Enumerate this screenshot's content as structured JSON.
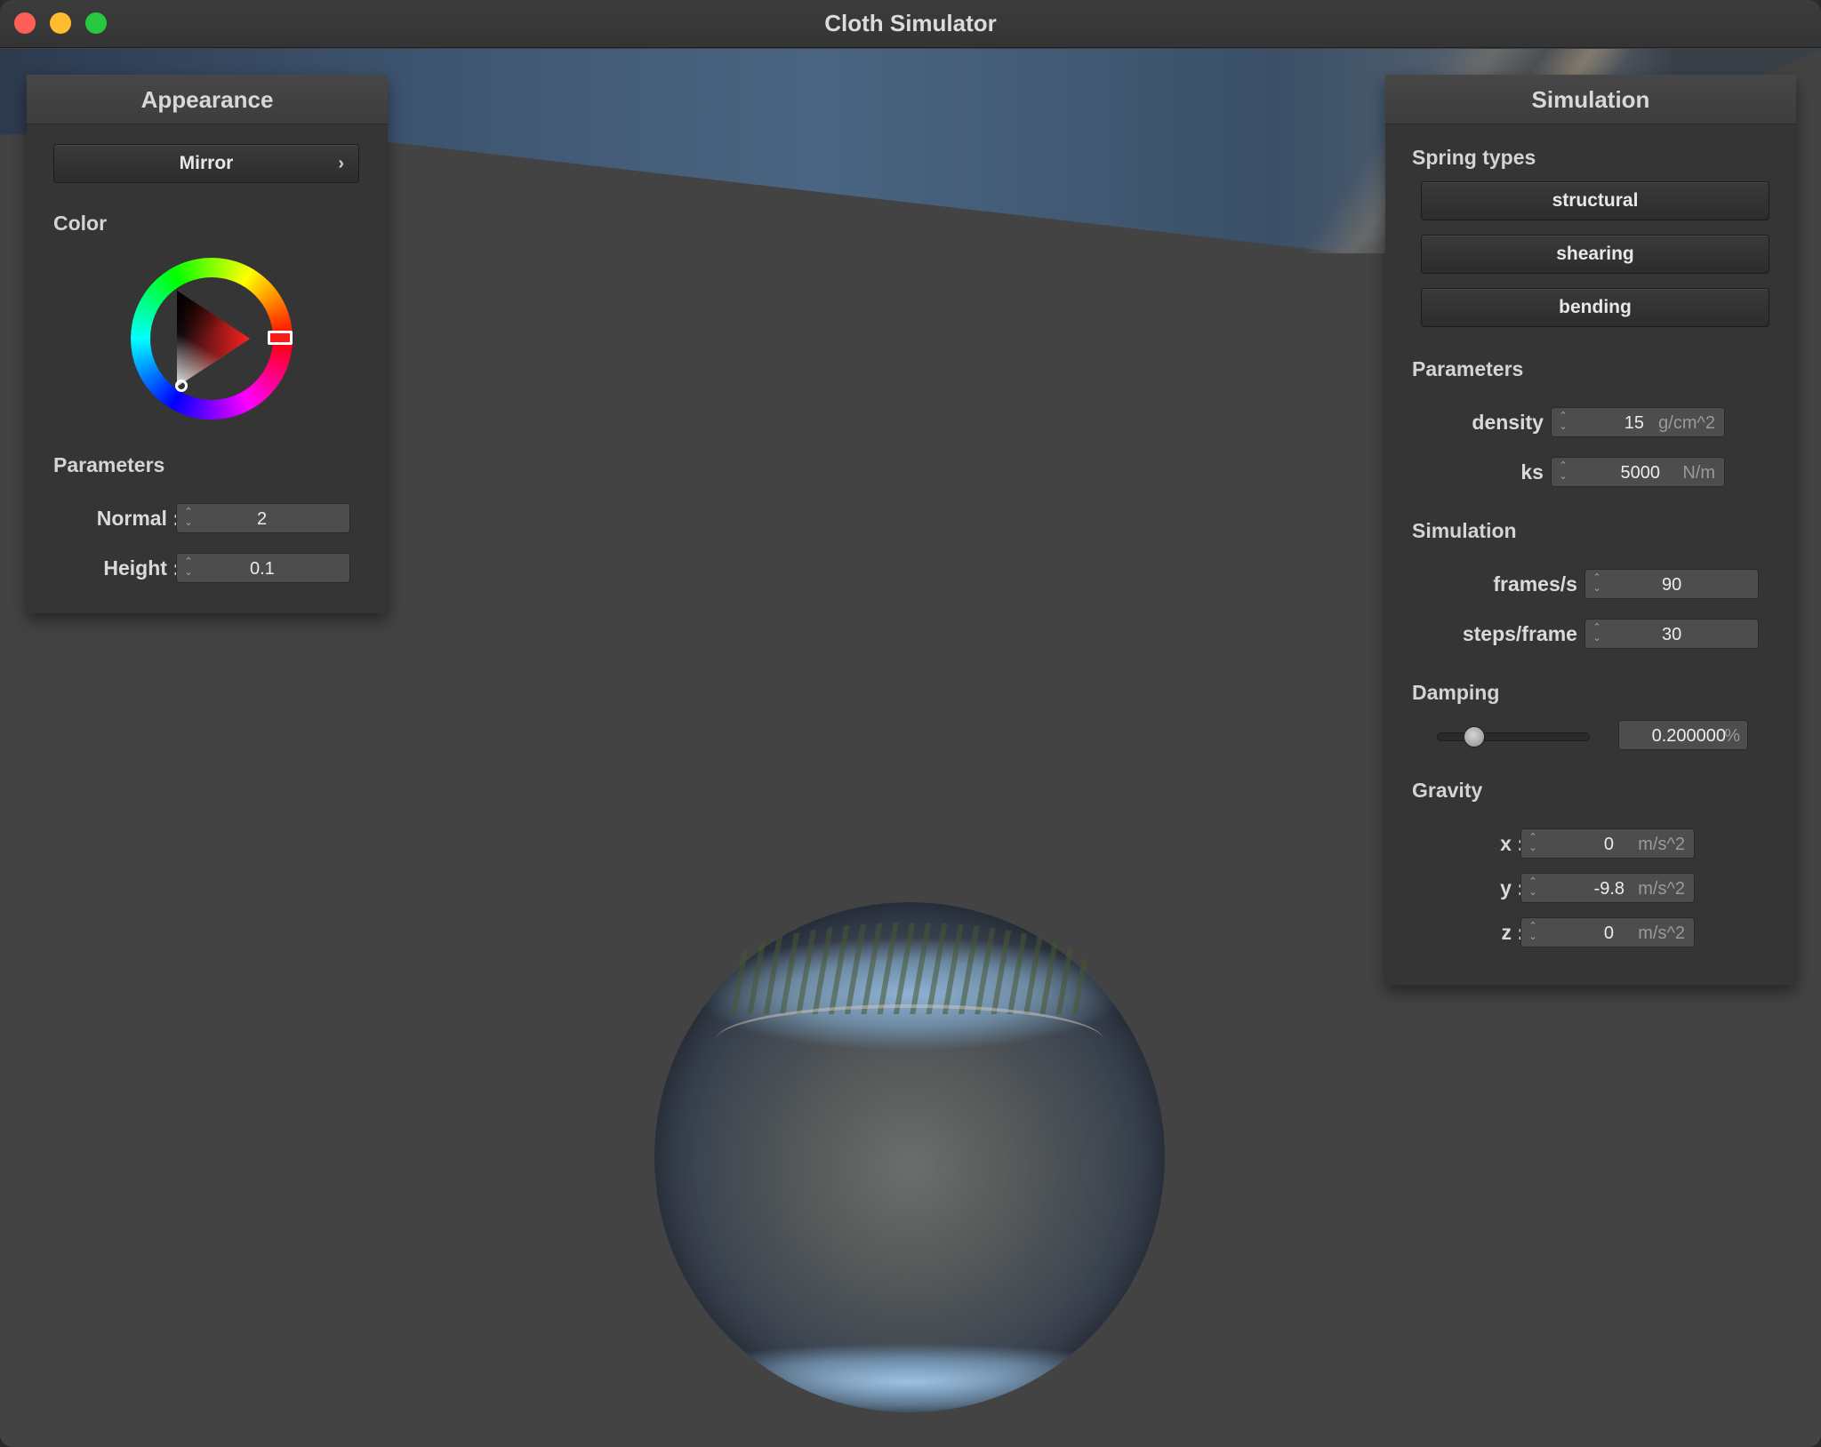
{
  "window": {
    "title": "Cloth Simulator"
  },
  "appearance": {
    "header": "Appearance",
    "shader_button": "Mirror",
    "color_title": "Color",
    "selected_color": "#ff1a1a",
    "params_title": "Parameters",
    "normal": {
      "label": "Normal :",
      "value": "2"
    },
    "height": {
      "label": "Height :",
      "value": "0.1"
    }
  },
  "simulation": {
    "header": "Simulation",
    "spring_title": "Spring types",
    "springs": [
      "structural",
      "shearing",
      "bending"
    ],
    "params_title": "Parameters",
    "density": {
      "label": "density :",
      "value": "15",
      "unit": "g/cm^2"
    },
    "ks": {
      "label": "ks :",
      "value": "5000",
      "unit": "N/m"
    },
    "sim_title": "Simulation",
    "fps": {
      "label": "frames/s :",
      "value": "90"
    },
    "steps": {
      "label": "steps/frame :",
      "value": "30"
    },
    "damping_title": "Damping",
    "damping": {
      "value": "0.200000",
      "unit": "%",
      "slider_fraction": 0.2
    },
    "gravity_title": "Gravity",
    "gx": {
      "label": "x :",
      "value": "0",
      "unit": "m/s^2"
    },
    "gy": {
      "label": "y :",
      "value": "-9.8",
      "unit": "m/s^2"
    },
    "gz": {
      "label": "z :",
      "value": "0",
      "unit": "m/s^2"
    }
  },
  "icons": {
    "chevron": "chevron-right-icon",
    "spinner": "spinner-arrows-icon"
  },
  "colors": {
    "close": "#fe5f57",
    "minimize": "#febc2e",
    "maximize": "#28c840"
  }
}
